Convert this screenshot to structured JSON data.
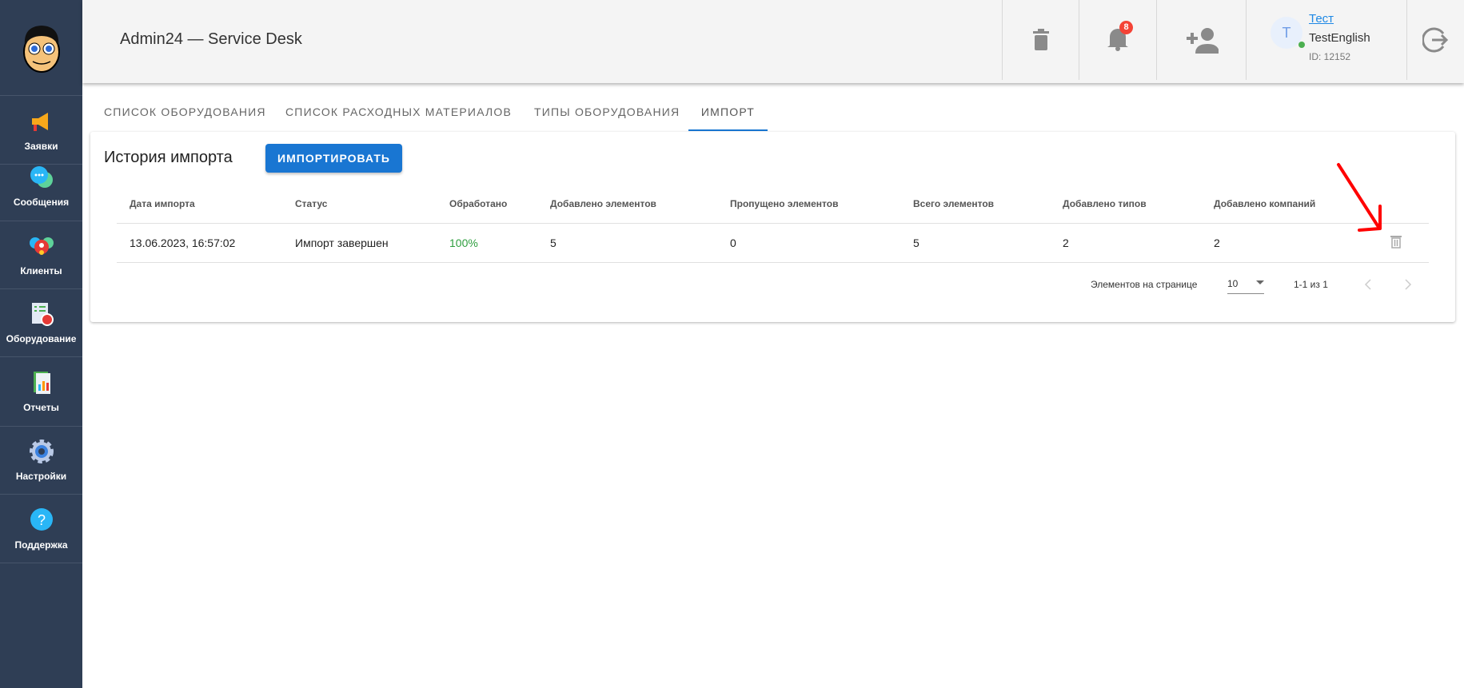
{
  "app": {
    "title": "Admin24 — Service Desk"
  },
  "sidebar": {
    "items": [
      {
        "label": "Заявки",
        "icon": "megaphone-icon"
      },
      {
        "label": "Сообщения",
        "icon": "chat-icon"
      },
      {
        "label": "Клиенты",
        "icon": "clients-icon"
      },
      {
        "label": "Оборудование",
        "icon": "equipment-icon"
      },
      {
        "label": "Отчеты",
        "icon": "reports-icon"
      },
      {
        "label": "Настройки",
        "icon": "gear-icon"
      },
      {
        "label": "Поддержка",
        "icon": "help-icon"
      }
    ]
  },
  "header": {
    "notifications_count": "8",
    "user": {
      "avatar_letter": "T",
      "name": "Тест",
      "login": "TestEnglish",
      "id": "ID: 12152"
    }
  },
  "tabs": [
    "СПИСОК ОБОРУДОВАНИЯ",
    "СПИСОК РАСХОДНЫХ МАТЕРИАЛОВ",
    "ТИПЫ ОБОРУДОВАНИЯ",
    "ИМПОРТ"
  ],
  "card": {
    "title": "История импорта",
    "import_button": "ИМПОРТИРОВАТЬ"
  },
  "table": {
    "columns": [
      "Дата импорта",
      "Статус",
      "Обработано",
      "Добавлено элементов",
      "Пропущено элементов",
      "Всего элементов",
      "Добавлено типов",
      "Добавлено компаний"
    ],
    "rows": [
      [
        "13.06.2023, 16:57:02",
        "Импорт завершен",
        "100%",
        "5",
        "0",
        "5",
        "2",
        "2"
      ]
    ]
  },
  "pagination": {
    "label": "Элементов на странице",
    "per_page": "10",
    "range": "1-1 из 1"
  },
  "colors": {
    "accent": "#1976d2",
    "sidebar": "#2f3e55",
    "success": "#2e9e3e",
    "badge": "#f44336"
  }
}
